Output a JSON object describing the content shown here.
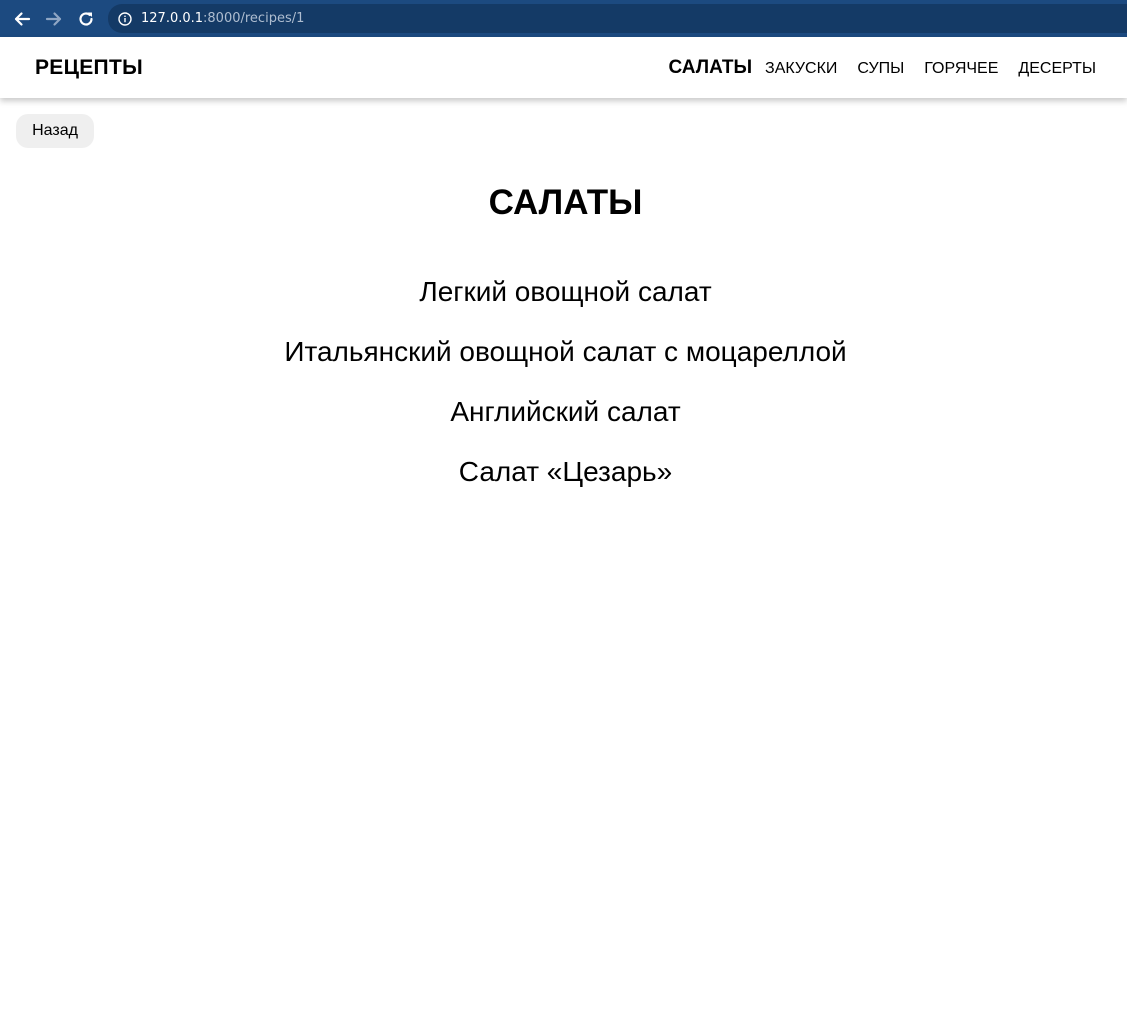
{
  "browser": {
    "url_host": "127.0.0.1",
    "url_rest": ":8000/recipes/1"
  },
  "header": {
    "logo": "РЕЦЕПТЫ",
    "nav": [
      {
        "label": "САЛАТЫ",
        "active": true
      },
      {
        "label": "ЗАКУСКИ",
        "active": false
      },
      {
        "label": "СУПЫ",
        "active": false
      },
      {
        "label": "ГОРЯЧЕЕ",
        "active": false
      },
      {
        "label": "ДЕСЕРТЫ",
        "active": false
      }
    ]
  },
  "back_button": {
    "label": "Назад"
  },
  "main": {
    "title": "САЛАТЫ",
    "recipes": [
      "Легкий овощной салат",
      "Итальянский овощной салат с моцареллой",
      "Английский салат",
      "Салат «Цезарь»"
    ]
  },
  "colors": {
    "browser_bar": "#1c4a80",
    "url_box": "#143a66",
    "back_button_bg": "#efefef"
  }
}
